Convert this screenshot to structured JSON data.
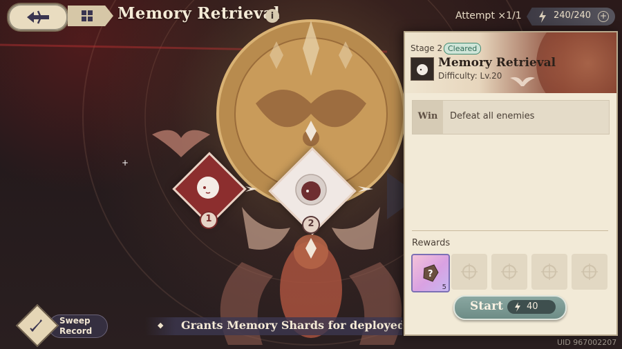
{
  "header": {
    "title": "Memory Retrieval",
    "info_glyph": "i",
    "attempt_text": "Attempt ×1/1",
    "stamina": "240/240",
    "stamina_plus": "+"
  },
  "icons": {
    "back": "back-arrow-icon",
    "menu": "grid-menu-icon",
    "stamina": "lightning-icon"
  },
  "stages": [
    {
      "number": "1",
      "state": "cleared"
    },
    {
      "number": "2",
      "state": "selected"
    }
  ],
  "sweep": {
    "label_line1": "Sweep",
    "label_line2": "Record"
  },
  "ticker": {
    "bullet": "◆",
    "text": "Grants Memory Shards for deployed cha"
  },
  "uid": "UID 967002207",
  "panel": {
    "stage_label": "Stage 2",
    "status_badge": "Cleared",
    "stage_title": "Memory Retrieval",
    "difficulty": "Difficulty: Lv.20",
    "win_label": "Win",
    "win_condition": "Defeat all enemies",
    "rewards_label": "Rewards",
    "rewards": [
      {
        "name": "random-shard",
        "qty": "5",
        "glyph": "?"
      },
      {
        "name": "empty"
      },
      {
        "name": "empty"
      },
      {
        "name": "empty"
      },
      {
        "name": "empty"
      }
    ],
    "start_label": "Start",
    "start_cost": "40"
  },
  "colors": {
    "accent_red": "#8c2e2e",
    "panel_bg": "#f2ead7",
    "start_button": "#7a9993",
    "cleared_green": "#3f8a71"
  }
}
